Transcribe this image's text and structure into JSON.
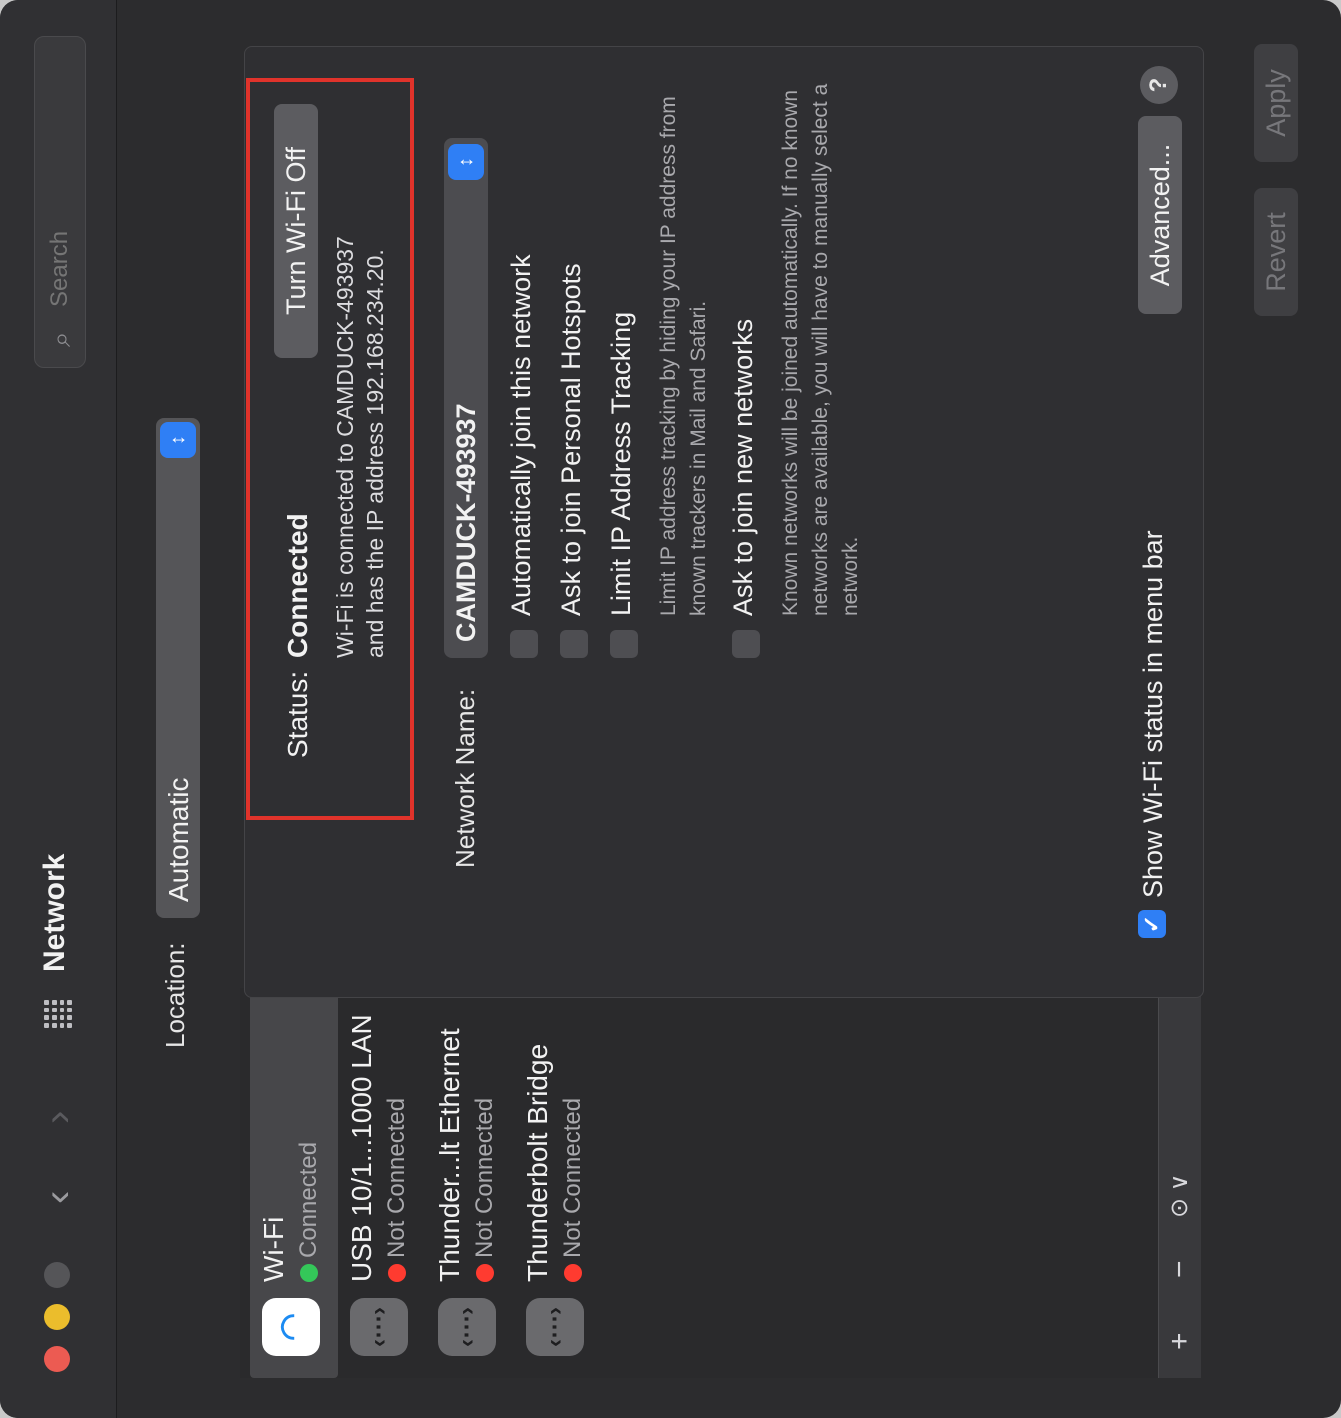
{
  "window": {
    "title": "Network",
    "search_placeholder": "Search",
    "icons": {
      "back": "chevron-left-icon",
      "forward": "chevron-right-icon",
      "all_prefs": "grid-icon",
      "search": "magnifier-icon"
    }
  },
  "location": {
    "label": "Location:",
    "value": "Automatic"
  },
  "services": [
    {
      "name": "Wi-Fi",
      "status": "Connected",
      "status_color": "#34c759",
      "icon": "wifi-icon",
      "selected": true
    },
    {
      "name": "USB 10/1...1000 LAN",
      "status": "Not Connected",
      "status_color": "#ff3b30",
      "icon": "ethernet-icon",
      "selected": false
    },
    {
      "name": "Thunder...lt Ethernet",
      "status": "Not Connected",
      "status_color": "#ff3b30",
      "icon": "ethernet-icon",
      "selected": false
    },
    {
      "name": "Thunderbolt Bridge",
      "status": "Not Connected",
      "status_color": "#ff3b30",
      "icon": "ethernet-icon",
      "selected": false
    }
  ],
  "service_controls": {
    "add": "+",
    "remove": "−",
    "action": "⊙ ∨"
  },
  "status": {
    "label": "Status:",
    "value": "Connected",
    "description": "Wi-Fi is connected to CAMDUCK-493937 and has the IP address 192.168.234.20.",
    "toggle_button": "Turn Wi-Fi Off"
  },
  "network_name": {
    "label": "Network Name:",
    "value": "CAMDUCK-493937"
  },
  "options": [
    {
      "label": "Automatically join this network",
      "checked": false
    },
    {
      "label": "Ask to join Personal Hotspots",
      "checked": false
    },
    {
      "label": "Limit IP Address Tracking",
      "checked": false,
      "hint": "Limit IP address tracking by hiding your IP address from known trackers in Mail and Safari."
    },
    {
      "label": "Ask to join new networks",
      "checked": false,
      "hint": "Known networks will be joined automatically. If no known networks are available, you will have to manually select a network."
    }
  ],
  "menu_bar_option": {
    "label": "Show Wi-Fi status in menu bar",
    "checked": true
  },
  "buttons": {
    "advanced": "Advanced...",
    "help": "?",
    "revert": "Revert",
    "apply": "Apply"
  },
  "colors": {
    "accent": "#2f7ff5",
    "highlight_box": "#e0332b"
  }
}
